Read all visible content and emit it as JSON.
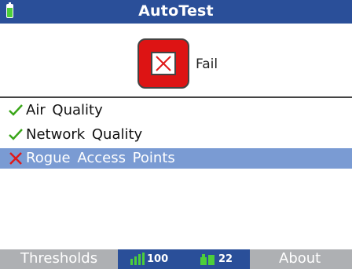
{
  "header": {
    "title": "AutoTest",
    "battery_icon": "battery-icon"
  },
  "result": {
    "status": "Fail",
    "icon": "x-icon",
    "color": "#dd1414"
  },
  "tests": [
    {
      "label": "Air Quality",
      "result": "pass"
    },
    {
      "label": "Network Quality",
      "result": "pass"
    },
    {
      "label": "Rogue Access Points",
      "result": "fail"
    }
  ],
  "footer": {
    "left_softkey": "Thresholds",
    "signal_value": "100",
    "device_count": "22",
    "right_softkey": "About"
  },
  "colors": {
    "header": "#2a4f99",
    "selected_row": "#7a9bd3",
    "pass": "#3aa619",
    "fail": "#e01818",
    "footer": "#aeb0b3"
  }
}
